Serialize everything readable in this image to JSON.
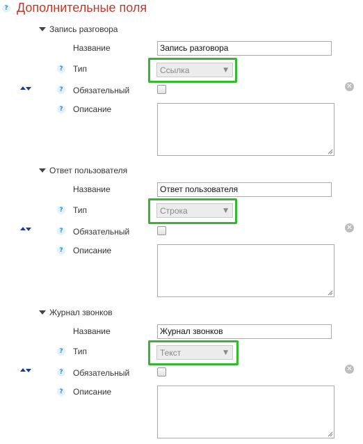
{
  "header": {
    "title": "Дополнительные поля",
    "help_glyph": "?"
  },
  "labels": {
    "name": "Название",
    "type": "Тип",
    "required": "Обязательный",
    "description": "Описание"
  },
  "fields": [
    {
      "section": "Запись разговора",
      "name_value": "Запись разговора",
      "type_value": "Ссылка",
      "required": false
    },
    {
      "section": "Ответ пользователя",
      "name_value": "Ответ пользователя",
      "type_value": "Строка",
      "required": false
    },
    {
      "section": "Журнал звонков",
      "name_value": "Журнал звонков",
      "type_value": "Текст",
      "required": false
    }
  ],
  "colors": {
    "title": "#c0392b",
    "highlight": "#34b830",
    "help": "#2e8fd6",
    "sort_arrows": "#1a3a9c"
  }
}
